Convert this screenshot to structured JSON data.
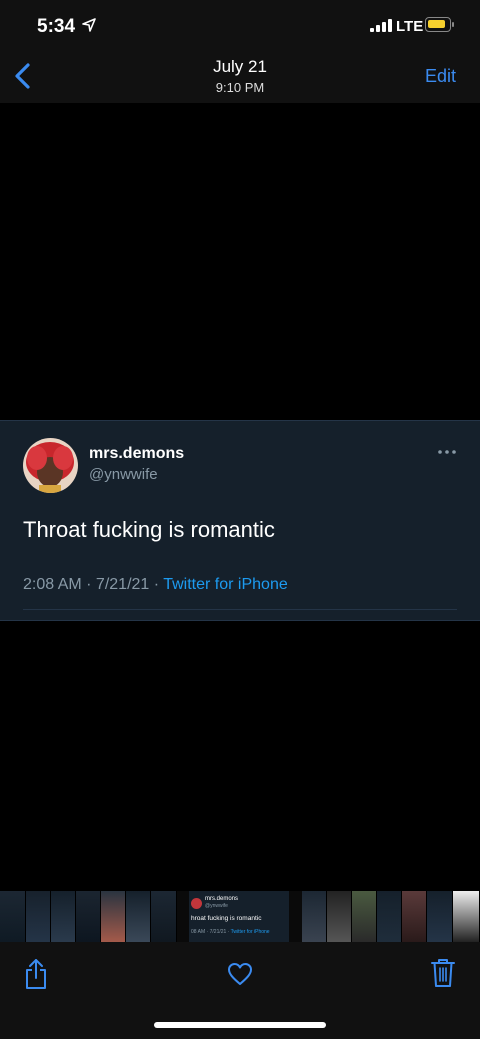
{
  "status_bar": {
    "time": "5:34",
    "carrier": "LTE",
    "battery_color": "#f6d02e",
    "icons": [
      "location-arrow-icon",
      "signal-bars-icon",
      "battery-icon"
    ]
  },
  "nav": {
    "title": "July 21",
    "subtitle": "9:10 PM",
    "edit_label": "Edit",
    "accent": "#3b8bf0"
  },
  "tweet": {
    "display_name": "mrs.demons",
    "handle": "@ynwwife",
    "text": "Throat fucking is romantic",
    "time": "2:08 AM · 7/21/21 · ",
    "source": "Twitter for iPhone",
    "background": "#15202b",
    "link_color": "#1d9bf0"
  },
  "thumbnail_strip": {
    "mini_tweet": {
      "name": "mrs.demons",
      "handle": "@ynwwife",
      "text": "hroat fucking is romantic",
      "meta": "08 AM · 7/21/21 · ",
      "source": "Twitter for iPhone"
    }
  },
  "toolbar": {
    "icons": [
      "share-icon",
      "heart-icon",
      "trash-icon"
    ]
  }
}
